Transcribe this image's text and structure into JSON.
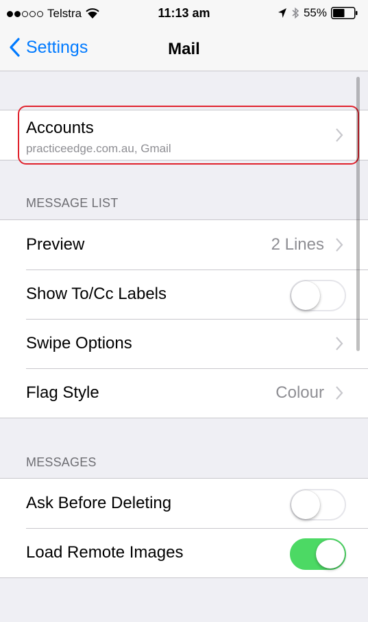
{
  "status_bar": {
    "signal_filled": 2,
    "signal_total": 5,
    "carrier": "Telstra",
    "time": "11:13 am",
    "battery_percent": "55%",
    "battery_level": 0.55,
    "icons": [
      "wifi-icon",
      "location-icon",
      "bluetooth-icon",
      "battery-icon"
    ]
  },
  "nav": {
    "back_label": "Settings",
    "title": "Mail"
  },
  "accounts": {
    "title": "Accounts",
    "subtitle": "practiceedge.com.au, Gmail"
  },
  "message_list": {
    "header": "MESSAGE LIST",
    "preview": {
      "label": "Preview",
      "value": "2 Lines"
    },
    "show_to_cc": {
      "label": "Show To/Cc Labels",
      "on": false
    },
    "swipe_options": {
      "label": "Swipe Options"
    },
    "flag_style": {
      "label": "Flag Style",
      "value": "Colour"
    }
  },
  "messages": {
    "header": "MESSAGES",
    "ask_before_deleting": {
      "label": "Ask Before Deleting",
      "on": false
    },
    "load_remote_images": {
      "label": "Load Remote Images",
      "on": true
    }
  },
  "colors": {
    "accent": "#007aff",
    "toggle_on": "#4cd964",
    "highlight": "#e0212c"
  }
}
